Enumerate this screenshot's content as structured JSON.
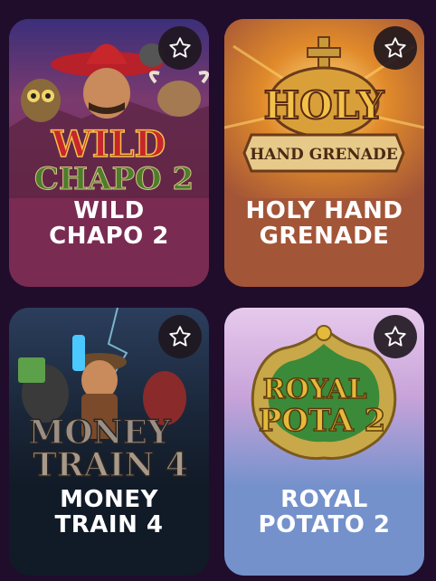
{
  "games": [
    {
      "title_line1": "WILD",
      "title_line2": "CHAPO 2",
      "logo_line1": "WILD",
      "logo_line2": "CHAPO 2",
      "colors": {
        "bg": "#7a2b52",
        "art_top": "#3b2f7a",
        "logo": "#c7262b",
        "logo2": "#4e7d2b"
      }
    },
    {
      "title_line1": "HOLY HAND",
      "title_line2": "GRENADE",
      "logo_line1": "HOLY",
      "logo_line2": "HAND GRENADE",
      "colors": {
        "bg": "#a35537",
        "art_top": "#e08a2b",
        "logo": "#f2c14a"
      }
    },
    {
      "title_line1": "MONEY",
      "title_line2": "TRAIN 4",
      "logo_line1": "MONEY",
      "logo_line2": "TRAIN 4",
      "colors": {
        "bg": "#111a27",
        "art_top": "#1f2f45",
        "logo": "#9a8f86"
      }
    },
    {
      "title_line1": "ROYAL",
      "title_line2": "POTATO 2",
      "logo_line1": "ROYAL",
      "logo_line2": "POTA 2",
      "colors": {
        "bg": "#7491cc",
        "art_top": "#d9b7e3",
        "logo": "#e4b93c"
      }
    }
  ],
  "icons": {
    "favorite": "star-outline-icon"
  }
}
